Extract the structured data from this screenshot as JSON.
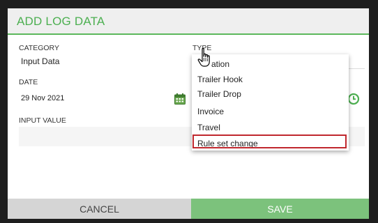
{
  "dialog": {
    "title": "ADD LOG DATA"
  },
  "form": {
    "category": {
      "label": "CATEGORY",
      "value": "Input Data"
    },
    "type": {
      "label": "TYPE"
    },
    "date": {
      "label": "DATE",
      "value": "29 Nov 2021"
    },
    "input_value": {
      "label": "INPUT VALUE",
      "value": ""
    }
  },
  "dropdown": {
    "items": [
      {
        "label": "ation"
      },
      {
        "label": "Trailer Hook"
      },
      {
        "label": "Trailer Drop"
      },
      {
        "label": "Invoice"
      },
      {
        "label": "Travel"
      },
      {
        "label": "Rule set change"
      }
    ],
    "highlighted_index": 5
  },
  "footer": {
    "cancel_label": "CANCEL",
    "save_label": "SAVE"
  },
  "colors": {
    "accent": "#4caf50",
    "save_bg": "#7cc27c",
    "highlight_border": "#c0272d"
  },
  "icons": [
    "calendar-icon",
    "clock-icon",
    "hand-pointer-icon"
  ]
}
